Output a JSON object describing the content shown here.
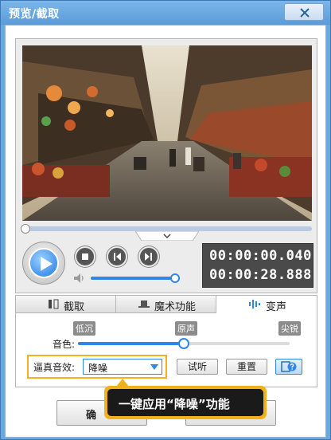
{
  "window": {
    "title": "预览/截取"
  },
  "player": {
    "current_time": "00:00:00.040",
    "total_time": "00:00:28.888",
    "seek_progress": 0.0,
    "volume_level": 0.95
  },
  "tabs": [
    {
      "label": "截取",
      "icon": "film-cut-icon"
    },
    {
      "label": "魔术功能",
      "icon": "magic-hat-icon"
    },
    {
      "label": "变声",
      "icon": "sound-wave-icon"
    }
  ],
  "voice_changer": {
    "pitch_label": "音色:",
    "pitch_low": "低沉",
    "pitch_mid": "原声",
    "pitch_high": "尖锐",
    "pitch_level": 0.5,
    "effect_label": "逼真音效:",
    "effect_value": "降噪",
    "preview_label": "试听",
    "reset_label": "重置"
  },
  "footer": {
    "confirm_label": "确"
  },
  "tooltip": {
    "text": "一键应用“降噪”功能"
  },
  "colors": {
    "accent": "#2f86e8",
    "highlight": "#f2b11c",
    "titlebar": "#5b9bd8"
  }
}
